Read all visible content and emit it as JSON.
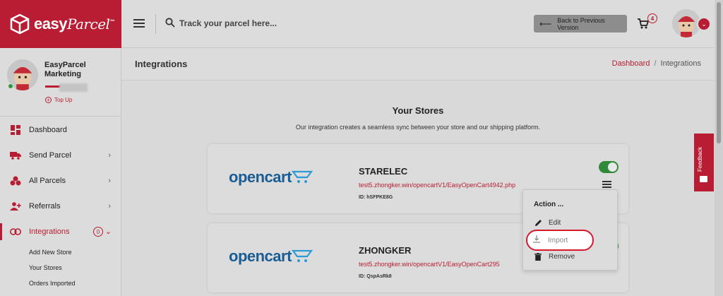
{
  "brand": {
    "name_plain": "easy",
    "name_script": "Parcel",
    "trademark": "™"
  },
  "header": {
    "search_placeholder": "Track your parcel here...",
    "back_button_label": "Back to Previous Version",
    "cart_count": "4"
  },
  "profile": {
    "name": "EasyParcel Marketing",
    "topup_label": "Top Up"
  },
  "nav": {
    "dashboard": "Dashboard",
    "send_parcel": "Send Parcel",
    "all_parcels": "All Parcels",
    "referrals": "Referrals",
    "integrations": "Integrations",
    "integrations_badge": "0",
    "sub": [
      "Add New Store",
      "Your Stores",
      "Orders Imported"
    ]
  },
  "page": {
    "title": "Integrations",
    "breadcrumb": [
      "Dashboard",
      "Integrations"
    ],
    "section_title": "Your Stores",
    "section_subtitle": "Our integration creates a seamless sync between your store and our shipping platform."
  },
  "stores": [
    {
      "platform": "opencart",
      "name": "STARELEC",
      "url": "test5.zhongker.win/opencartV1/EasyOpenCart4942.php",
      "id": "ID: hSFPKE8G",
      "enabled": true
    },
    {
      "platform": "opencart",
      "name": "ZHONGKER",
      "url": "test5.zhongker.win/opencartV1/EasyOpenCart295",
      "id": "ID: QspAsRk8",
      "enabled": true
    }
  ],
  "dropdown": {
    "title": "Action ...",
    "edit": "Edit",
    "import": "Import",
    "remove": "Remove"
  },
  "feedback_label": "Feedback",
  "colors": {
    "brand_red": "#b81d33",
    "toggle_green": "#2f8a3a",
    "opencart_blue": "#1a5d95",
    "highlight_red": "#d8182d"
  }
}
